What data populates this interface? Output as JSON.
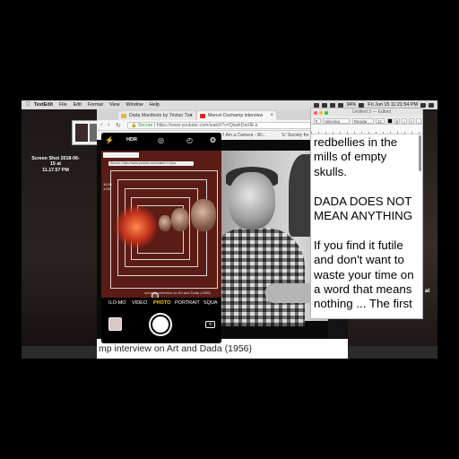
{
  "menubar": {
    "apple": "",
    "app": "TextEdit",
    "items": [
      "File",
      "Edit",
      "Format",
      "View",
      "Window",
      "Help"
    ],
    "battery": "94%",
    "clock": "Fri Jun 15  11:21:54 PM"
  },
  "desktop": {
    "screenshot_label_line1": "Screen Shot 2018-06-15 at",
    "screenshot_label_line2": "11.17.57 PM",
    "edge_text": "at"
  },
  "browser": {
    "tabs": [
      {
        "title": "Dada Manifesto by Tristan Tza"
      },
      {
        "title": "Marcel Duchamp interview"
      }
    ],
    "address_secure": "Secure",
    "address_url": "https://www.youtube.com/watch?v=QswkDer0E.k",
    "bookmarks": [
      "'I Am a Camera - Wi...",
      "'ic' Society for the Di"
    ],
    "caption": "mp interview on Art and Dada (1956)"
  },
  "phone": {
    "hdr": "HDR",
    "modes": [
      "ILO-MO",
      "VIDEO",
      "PHOTO",
      "PORTRAIT",
      "SQUA"
    ],
    "active_mode": "PHOTO",
    "inner_time": "11:09",
    "inner_sub": "1:03",
    "inner_caption": "uchamp interview on Art and Dada (1956)",
    "inner_addr": "Secure | https://www.youtube.com/watch?v=Qsw"
  },
  "textedit": {
    "title": "Untitled 2 — Edited",
    "font": "Helvetica",
    "style": "Regular",
    "size": "12",
    "lines": [
      "redbellies in the",
      "mills of empty",
      "skulls.",
      "",
      "DADA DOES NOT",
      "MEAN ANYTHING",
      "",
      "If you find it futile",
      "and don't want to",
      "waste your time on",
      "a word that means",
      "nothing ... The first"
    ]
  },
  "colors": {
    "menubar_bg": "#dcdcdc",
    "secure_green": "#1c8c3c",
    "camera_active_mode": "#ffcc00",
    "viewfinder_red": "#c0301c"
  }
}
